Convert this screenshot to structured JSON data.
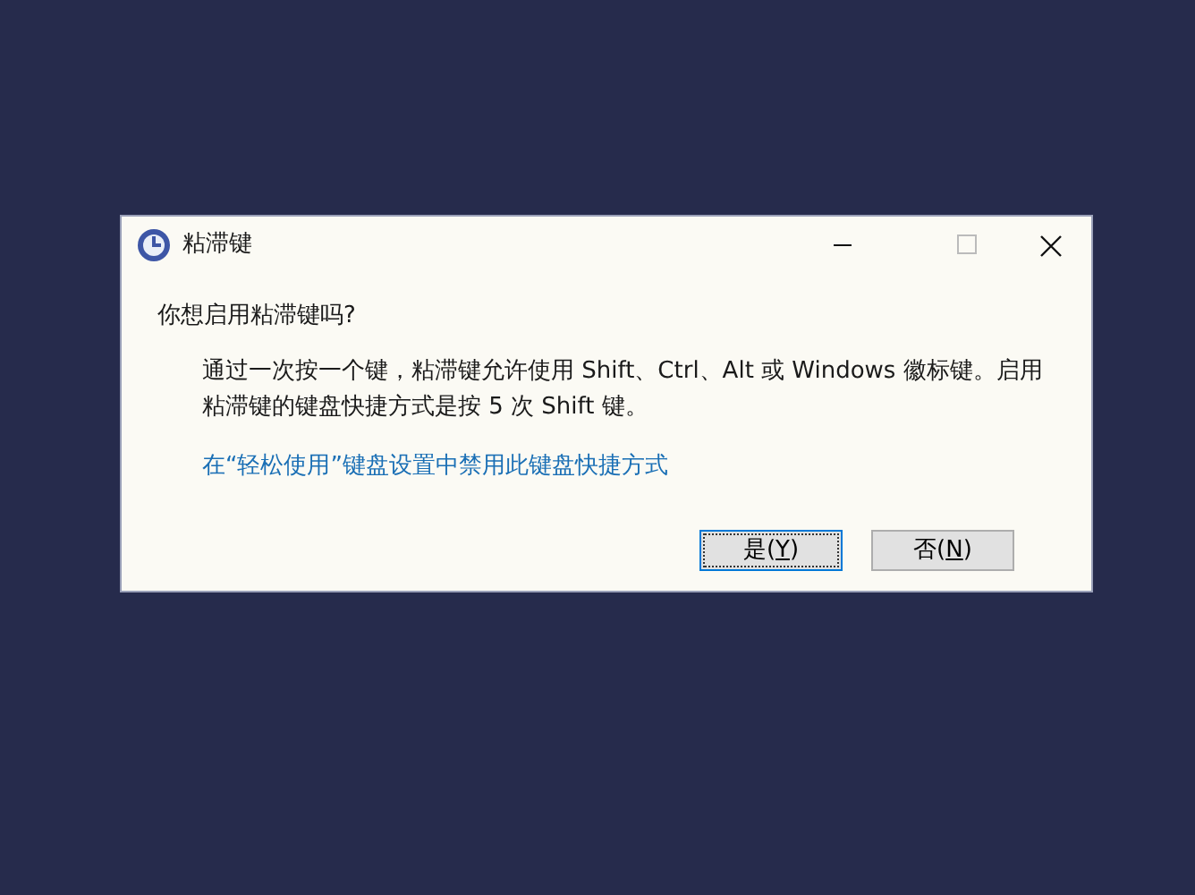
{
  "window": {
    "title": "粘滞键"
  },
  "question": "你想启用粘滞键吗?",
  "description": "通过一次按一个键，粘滞键允许使用 Shift、Ctrl、Alt 或 Windows 徽标键。启用粘滞键的键盘快捷方式是按 5 次 Shift 键。",
  "link": "在“轻松使用”键盘设置中禁用此键盘快捷方式",
  "buttons": [
    {
      "label_before": "是(",
      "access_key": "Y",
      "label_after": ")",
      "focused": true
    },
    {
      "label_before": "否(",
      "access_key": "N",
      "label_after": ")",
      "focused": false
    }
  ]
}
